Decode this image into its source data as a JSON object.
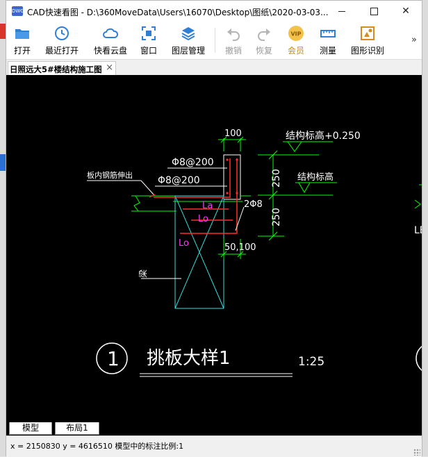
{
  "window": {
    "title": "CAD快速看图 - D:\\360MoveData\\Users\\16070\\Desktop\\图纸\\2020-03-03..."
  },
  "toolbar": {
    "open": "打开",
    "recent": "最近打开",
    "cloud": "快看云盘",
    "window": "窗口",
    "layers": "图层管理",
    "undo": "撤销",
    "redo": "恢复",
    "vip": "会员",
    "measure": "测量",
    "recognize": "图形识别",
    "more": "»"
  },
  "tab": {
    "title": "日照远大5#楼结构施工图",
    "close": "×"
  },
  "drawing": {
    "dim_100": "100",
    "elev_top": "结构标高+0.250",
    "elev_mid": "结构标高",
    "bar_1": "Φ8@200",
    "bar_2": "Φ8@200",
    "note_slab": "板内钢筋伸出",
    "dim_250_top": "250",
    "dim_250_bot": "250",
    "label_2phi8": "2Φ8",
    "la_1": "La",
    "lo_1": "Lo",
    "lo_2": "Lo",
    "dim_50_100": "50,100",
    "beam": "梁",
    "detail_num": "1",
    "detail_title": "挑板大样1",
    "scale": "1:25",
    "edge_text": "LE"
  },
  "layout_tabs": [
    "模型",
    "布局1"
  ],
  "status": "x = 2150830  y = 4616510  模型中的标注比例:1",
  "colors": {
    "green": "#00ff00",
    "cyan": "#33dede",
    "red": "#ff2a2a",
    "magenta": "#ff33ff",
    "white": "#ffffff"
  }
}
